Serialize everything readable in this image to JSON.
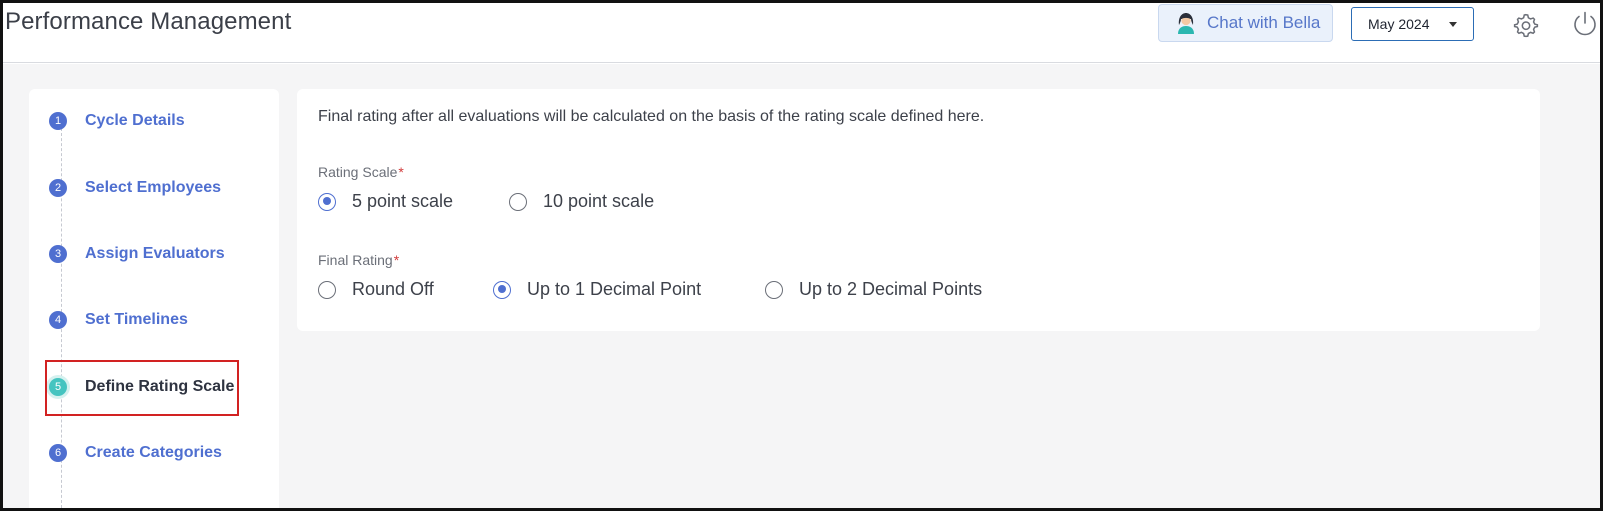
{
  "header": {
    "title": "Performance Management",
    "chat_label": "Chat with Bella",
    "month": "May 2024",
    "icons": {
      "chat": "bella-avatar-icon",
      "month": "chevron-down-icon",
      "settings": "gear-icon",
      "logout": "power-icon"
    }
  },
  "steps": [
    {
      "number": "1",
      "label": "Cycle Details",
      "active": false
    },
    {
      "number": "2",
      "label": "Select Employees",
      "active": false
    },
    {
      "number": "3",
      "label": "Assign Evaluators",
      "active": false
    },
    {
      "number": "4",
      "label": "Set Timelines",
      "active": false
    },
    {
      "number": "5",
      "label": "Define Rating Scale",
      "active": true
    },
    {
      "number": "6",
      "label": "Create Categories",
      "active": false
    }
  ],
  "main": {
    "intro": "Final rating after all evaluations will be calculated on the basis of the rating scale defined here.",
    "rating_scale": {
      "label": "Rating Scale",
      "required_mark": "*",
      "options": [
        "5 point scale",
        "10 point scale"
      ],
      "selected": "5 point scale"
    },
    "final_rating": {
      "label": "Final Rating",
      "required_mark": "*",
      "options": [
        "Round Off",
        "Up to 1 Decimal Point",
        "Up to 2 Decimal Points"
      ],
      "selected": "Up to 1 Decimal Point"
    }
  },
  "colors": {
    "accent": "#4f6fd0",
    "active_step": "#45c4c0",
    "required": "#d23b3b",
    "highlight": "#d22222",
    "content_bg": "#f5f5f6"
  }
}
